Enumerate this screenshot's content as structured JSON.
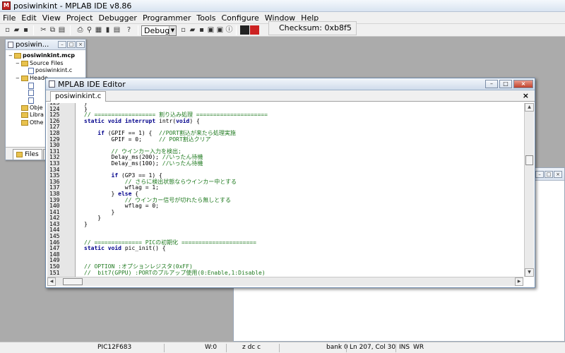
{
  "window": {
    "title": "posiwinkint - MPLAB IDE v8.86"
  },
  "menu": [
    "File",
    "Edit",
    "View",
    "Project",
    "Debugger",
    "Programmer",
    "Tools",
    "Configure",
    "Window",
    "Help"
  ],
  "toolbar": {
    "build_config": "Debug",
    "checksum": "Checksum:  0xb8f5"
  },
  "project_window": {
    "title": "posiwin...",
    "root": "posiwinkint.mcp",
    "folders": [
      "Source Files",
      "Header Files",
      "Object Files",
      "Library Files",
      "Other Files"
    ],
    "visible_folder_labels": [
      "Heade",
      "Obje",
      "Libra",
      "Othe"
    ],
    "source_file": "posiwinkint.c",
    "tab_files": "Files"
  },
  "editor": {
    "title": "MPLAB IDE Editor",
    "tab": "posiwinkint.c",
    "lines": [
      {
        "n": "123",
        "t": "}"
      },
      {
        "n": "124",
        "t": "}"
      },
      {
        "n": "125",
        "t": "// ================== 割り込み処理 ====================="
      },
      {
        "n": "126",
        "t": "static void interrupt intr(void) {"
      },
      {
        "n": "127",
        "t": ""
      },
      {
        "n": "128",
        "t": "    if (GPIF == 1) {  //PORT割込が来たら処理実施"
      },
      {
        "n": "129",
        "t": "        GPIF = 0;     // PORT割込クリア"
      },
      {
        "n": "130",
        "t": ""
      },
      {
        "n": "131",
        "t": "        // ウインカー入力を検出;"
      },
      {
        "n": "132",
        "t": "        Delay_ms(200); //いったん待機"
      },
      {
        "n": "133",
        "t": "        Delay_ms(100); //いったん待機"
      },
      {
        "n": "134",
        "t": ""
      },
      {
        "n": "135",
        "t": "        if (GP3 == 1) {"
      },
      {
        "n": "136",
        "t": "            // さらに検出状態ならウインカー中とする"
      },
      {
        "n": "137",
        "t": "            wflag = 1;"
      },
      {
        "n": "138",
        "t": "        } else {"
      },
      {
        "n": "139",
        "t": "            // ウインカー信号が切れたら無しとする"
      },
      {
        "n": "140",
        "t": "            wflag = 0;"
      },
      {
        "n": "141",
        "t": "        }"
      },
      {
        "n": "142",
        "t": "    }"
      },
      {
        "n": "143",
        "t": "}"
      },
      {
        "n": "144",
        "t": ""
      },
      {
        "n": "145",
        "t": ""
      },
      {
        "n": "146",
        "t": "// ============== PICの初期化 ======================"
      },
      {
        "n": "147",
        "t": "static void pic_init() {"
      },
      {
        "n": "148",
        "t": ""
      },
      {
        "n": "149",
        "t": ""
      },
      {
        "n": "150",
        "t": "// OPTION :オプションレジスタ(0xFF)"
      },
      {
        "n": "151",
        "t": "//  bit7(GPPU) :PORTのプルアップ使用(0:Enable,1:Disable)"
      }
    ]
  },
  "status": {
    "device": "PIC12F683",
    "w": "W:0",
    "flags": "z dc c",
    "bank": "bank 0",
    "position": "Ln 207, Col 30",
    "ins": "INS",
    "wr": "WR"
  }
}
